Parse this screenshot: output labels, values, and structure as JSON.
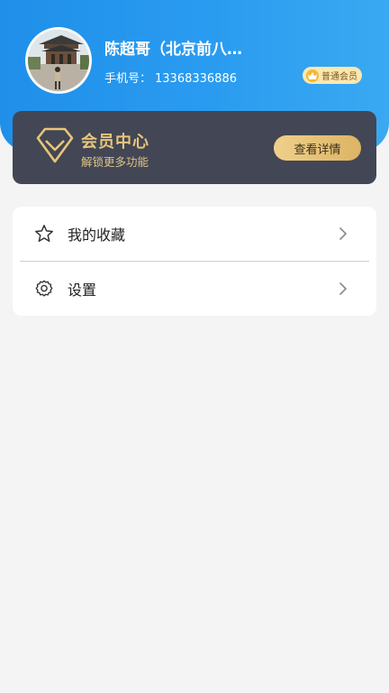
{
  "profile": {
    "name": "陈超哥（北京前八…",
    "phone_label": "手机号：",
    "phone_value": "13368336886",
    "badge_label": "普通会员",
    "badge_icon": "crown-icon"
  },
  "vip_card": {
    "title": "会员中心",
    "subtitle": "解锁更多功能",
    "button_label": "查看详情",
    "logo_icon": "diamond-icon"
  },
  "menu": {
    "items": [
      {
        "label": "我的收藏",
        "icon": "star-icon"
      },
      {
        "label": "设置",
        "icon": "gear-icon"
      }
    ]
  },
  "colors": {
    "header_blue": "#2196f3",
    "vip_card_bg": "#434654",
    "vip_gold": "#e7c67a",
    "page_bg": "#f4f4f4"
  }
}
